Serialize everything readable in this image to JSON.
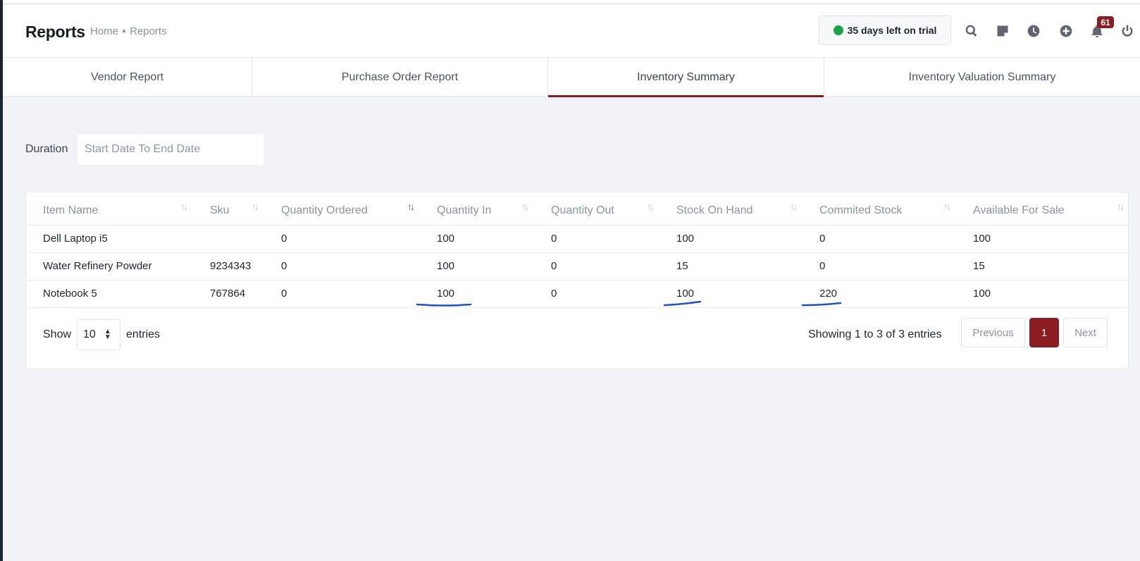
{
  "header": {
    "title": "Reports",
    "breadcrumb": [
      "Home",
      "Reports"
    ],
    "trial_text": "35 days left on trial",
    "notification_count": "61",
    "icons": [
      "search-icon",
      "notes-icon",
      "clock-icon",
      "add-circle-icon",
      "bell-icon",
      "power-icon"
    ],
    "trial_status_color": "#1ea446"
  },
  "tabs": [
    {
      "label": "Vendor Report",
      "active": false
    },
    {
      "label": "Purchase Order Report",
      "active": false
    },
    {
      "label": "Inventory Summary",
      "active": true
    },
    {
      "label": "Inventory Valuation Summary",
      "active": false
    }
  ],
  "filter": {
    "duration_label": "Duration",
    "date_placeholder": "Start Date To End Date"
  },
  "table": {
    "columns": [
      "Item Name",
      "Sku",
      "Quantity Ordered",
      "Quantity In",
      "Quantity Out",
      "Stock On Hand",
      "Commited Stock",
      "Available For Sale"
    ],
    "rows": [
      [
        "Dell Laptop i5",
        "",
        "0",
        "100",
        "0",
        "100",
        "0",
        "100"
      ],
      [
        "Water Refinery Powder",
        "9234343",
        "0",
        "100",
        "0",
        "15",
        "0",
        "15"
      ],
      [
        "Notebook 5",
        "767864",
        "0",
        "100",
        "0",
        "100",
        "220",
        "100"
      ]
    ]
  },
  "footer": {
    "show_label": "Show",
    "page_size": "10",
    "entries_label": "entries",
    "info": "Showing 1 to 3 of 3 entries",
    "prev_label": "Previous",
    "current_page": "1",
    "next_label": "Next"
  },
  "colors": {
    "accent": "#8c1d22",
    "annotation": "#1f4fd6"
  }
}
